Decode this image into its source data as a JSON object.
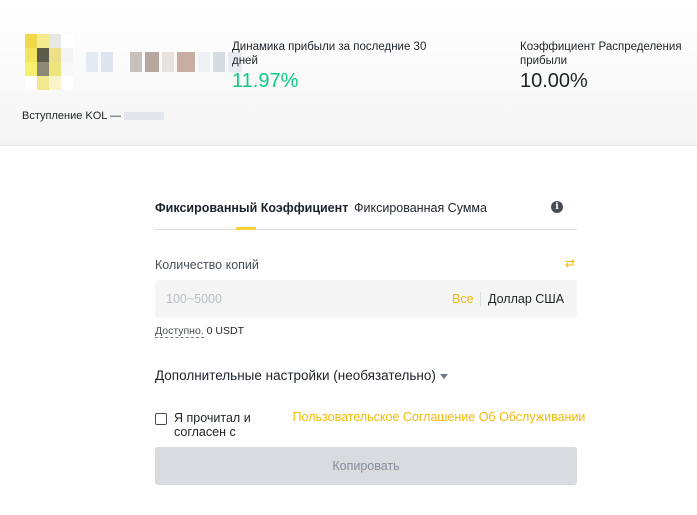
{
  "header": {
    "kol_label": "Вступление KOL —",
    "profit_label": "Динамика прибыли за последние 30 дней",
    "profit_value": "11.97%",
    "ratio_label": "Коэффициент Распределения прибыли",
    "ratio_value": "10.00%",
    "colors": {
      "profit": "#0ecb81",
      "accent": "#f0b90b"
    }
  },
  "tabs": [
    {
      "label": "Фиксированный Коэффициент",
      "active": true
    },
    {
      "label": "Фиксированная Сумма",
      "active": false
    }
  ],
  "amount": {
    "label": "Количество копий",
    "placeholder": "100~5000",
    "max_label": "Все",
    "currency": "Доллар США"
  },
  "available": {
    "label": "Доступно.",
    "value": "0 USDT"
  },
  "advanced": {
    "label": "Дополнительные настройки (необязательно)"
  },
  "agreement": {
    "text": "Я прочитал и согласен с",
    "link": "Пользовательское Соглашение Об Обслуживании"
  },
  "copy_button": {
    "label": "Копировать"
  },
  "icons": [
    "info-icon",
    "swap-icon",
    "caret-down-icon",
    "checkbox-icon"
  ]
}
